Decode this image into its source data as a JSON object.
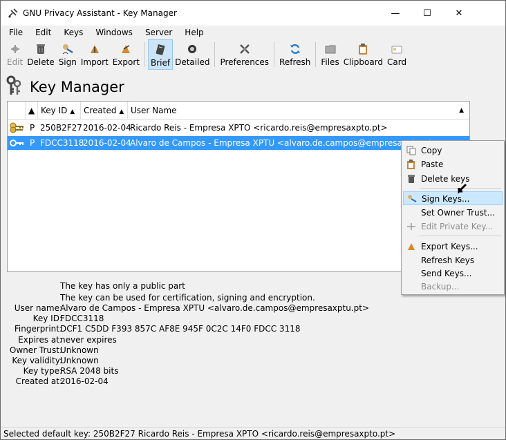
{
  "window": {
    "title": "GNU Privacy Assistant - Key Manager",
    "controls": {
      "minimize": "—",
      "maximize": "☐",
      "close": "✕"
    }
  },
  "menubar": [
    "File",
    "Edit",
    "Keys",
    "Windows",
    "Server",
    "Help"
  ],
  "toolbar": [
    {
      "label": "Edit",
      "icon": "edit-icon",
      "disabled": true
    },
    {
      "label": "Delete",
      "icon": "trash-icon"
    },
    {
      "label": "Sign",
      "icon": "sign-icon"
    },
    {
      "label": "Import",
      "icon": "import-icon"
    },
    {
      "label": "Export",
      "icon": "export-icon"
    },
    {
      "label": "Brief",
      "icon": "brief-icon",
      "active": true
    },
    {
      "label": "Detailed",
      "icon": "detailed-icon"
    },
    {
      "label": "Preferences",
      "icon": "preferences-icon"
    },
    {
      "label": "Refresh",
      "icon": "refresh-icon"
    },
    {
      "label": "Files",
      "icon": "folder-icon"
    },
    {
      "label": "Clipboard",
      "icon": "clipboard-icon"
    },
    {
      "label": "Card",
      "icon": "card-icon"
    }
  ],
  "heading": "Key Manager",
  "key_list": {
    "columns": [
      "Key ID",
      "Created",
      "User Name"
    ],
    "rows": [
      {
        "type": "P",
        "key_id": "250B2F27",
        "created": "2016-02-04",
        "user": "Ricardo Reis - Empresa XPTO <ricardo.reis@empresaxpto.pt>",
        "selected": false
      },
      {
        "type": "P",
        "key_id": "FDCC3118",
        "created": "2016-02-04",
        "user": "Alvaro de Campos - Empresa XPTU <alvaro.de.campos@empresaxptu.pt>",
        "selected": true
      }
    ]
  },
  "details": {
    "notes": [
      "The key has only a public part",
      "The key can be used for certification, signing and encryption."
    ],
    "fields": [
      {
        "label": "User name:",
        "value": "Alvaro de Campos - Empresa XPTU <alvaro.de.campos@empresaxptu.pt>"
      },
      {
        "label": "Key ID:",
        "value": "FDCC3118"
      },
      {
        "label": "Fingerprint:",
        "value": "DCF1 C5DD F393 857C AF8E  945F 0C2C 14F0 FDCC 3118"
      },
      {
        "label": "Expires at:",
        "value": "never expires"
      },
      {
        "label": "Owner Trust:",
        "value": "Unknown"
      },
      {
        "label": "Key validity:",
        "value": "Unknown"
      },
      {
        "label": "Key type:",
        "value": "RSA 2048 bits"
      },
      {
        "label": "Created at:",
        "value": "2016-02-04"
      }
    ]
  },
  "statusbar": "Selected default key:  250B2F27  Ricardo Reis - Empresa XPTO <ricardo.reis@empresaxpto.pt>",
  "context_menu": [
    {
      "label": "Copy",
      "icon": "copy-icon"
    },
    {
      "label": "Paste",
      "icon": "paste-icon"
    },
    {
      "label": "Delete keys",
      "icon": "trash-icon"
    },
    {
      "separator": true
    },
    {
      "label": "Sign Keys...",
      "icon": "sign-icon",
      "highlight": true
    },
    {
      "label": "Set Owner Trust...",
      "icon": ""
    },
    {
      "label": "Edit Private Key...",
      "icon": "edit-icon",
      "disabled": true
    },
    {
      "separator": true
    },
    {
      "label": "Export Keys...",
      "icon": "export-icon"
    },
    {
      "label": "Refresh Keys",
      "icon": ""
    },
    {
      "label": "Send Keys...",
      "icon": ""
    },
    {
      "label": "Backup...",
      "icon": "",
      "disabled": true
    }
  ],
  "colors": {
    "selection": "#3399ff",
    "menu_highlight": "#cce8ff"
  }
}
